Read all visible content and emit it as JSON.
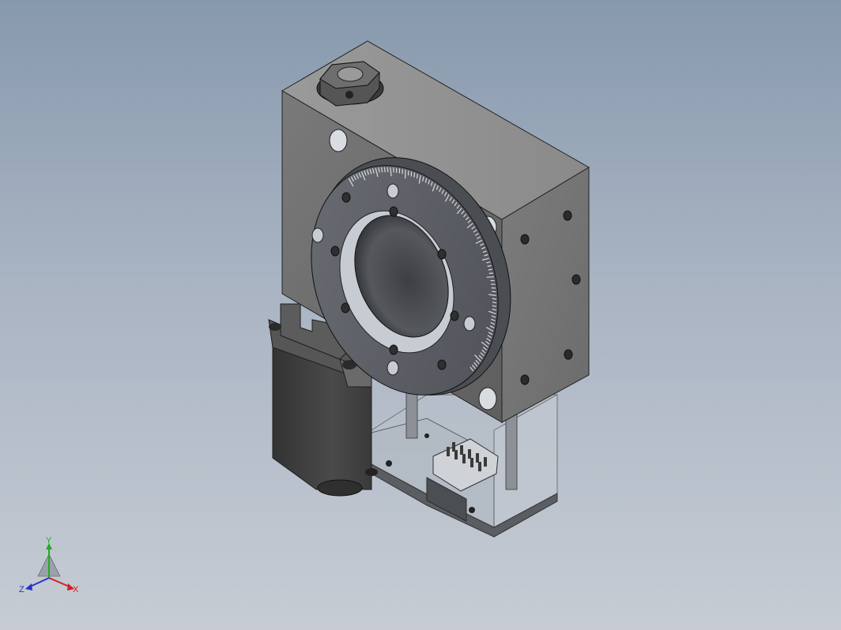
{
  "viewport": {
    "background_top": "#8799ad",
    "background_bottom": "#c7ccd4"
  },
  "model": {
    "body_color": "#6e6e6e",
    "ring_color": "#5a5d63",
    "motor_color": "#3e3e3e",
    "housing_color": "#b9c0c9"
  },
  "triad": {
    "x_label": "X",
    "y_label": "Y",
    "z_label": "Z",
    "x_color": "#cc2222",
    "y_color": "#22aa22",
    "z_color": "#2233cc"
  }
}
